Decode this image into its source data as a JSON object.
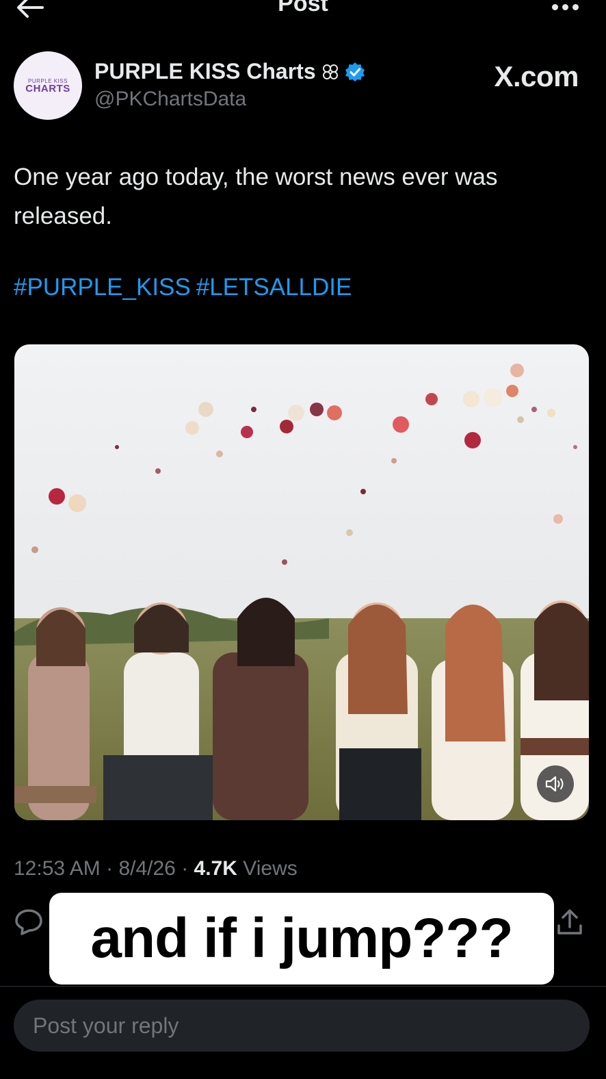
{
  "header": {
    "title": "Post",
    "back_icon": "arrow-left-icon",
    "more_icon": "more-horizontal-icon"
  },
  "author": {
    "display_name": "PURPLE KISS Charts",
    "handle": "@PKChartsData",
    "avatar_text_small": "PURPLE KISS",
    "avatar_text_big": "CHARTS",
    "badges": [
      "flower-icon",
      "verified-badge-icon"
    ],
    "verified_color": "#1d9bf0"
  },
  "watermark": "X.com",
  "tweet": {
    "text": "One year ago today, the worst news ever was released.",
    "hashtags": [
      "#PURPLE_KISS",
      "#LETSALLDIE"
    ],
    "hashtag_color": "#1d9bf0"
  },
  "media": {
    "sound_icon": "speaker-icon"
  },
  "meta": {
    "time": "12:53 AM",
    "date": "8/4/26",
    "views_count": "4.7K",
    "views_label": "Views"
  },
  "caption_overlay": "and if i jump???",
  "actions": {
    "reply_icon": "reply-icon",
    "share_icon": "share-icon"
  },
  "reply_box": {
    "placeholder": "Post your reply"
  }
}
